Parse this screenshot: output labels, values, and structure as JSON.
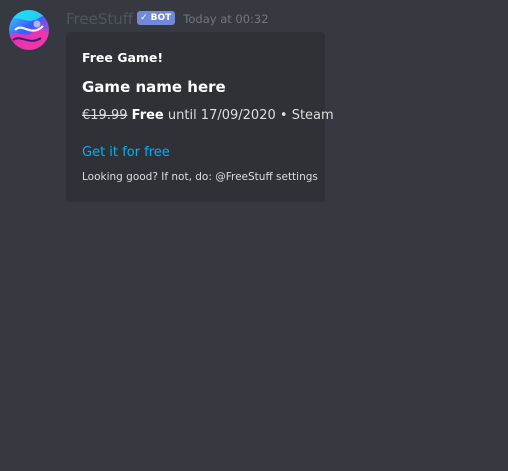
{
  "message": {
    "author": {
      "username": "FreeStuff",
      "bot_tag": "BOT",
      "bot_check_icon": "checkmark-icon",
      "avatar_icon": "abstract-avatar-icon"
    },
    "timestamp": "Today at 00:32",
    "embed": {
      "author": "Free Game!",
      "title": "Game name here",
      "description": {
        "old_price": "€19.99",
        "free_label": "Free",
        "until_text": "until 17/09/2020",
        "separator": "•",
        "store": "Steam"
      },
      "link_text": "Get it for free",
      "footer": "Looking good? If not, do: @FreeStuff settings"
    }
  },
  "colors": {
    "background": "#36393f",
    "embed_background": "#2f3136",
    "bot_tag": "#7289da",
    "link": "#00b0f4",
    "username": "#4f5660",
    "timestamp": "#72767d",
    "text": "#dcddde"
  }
}
